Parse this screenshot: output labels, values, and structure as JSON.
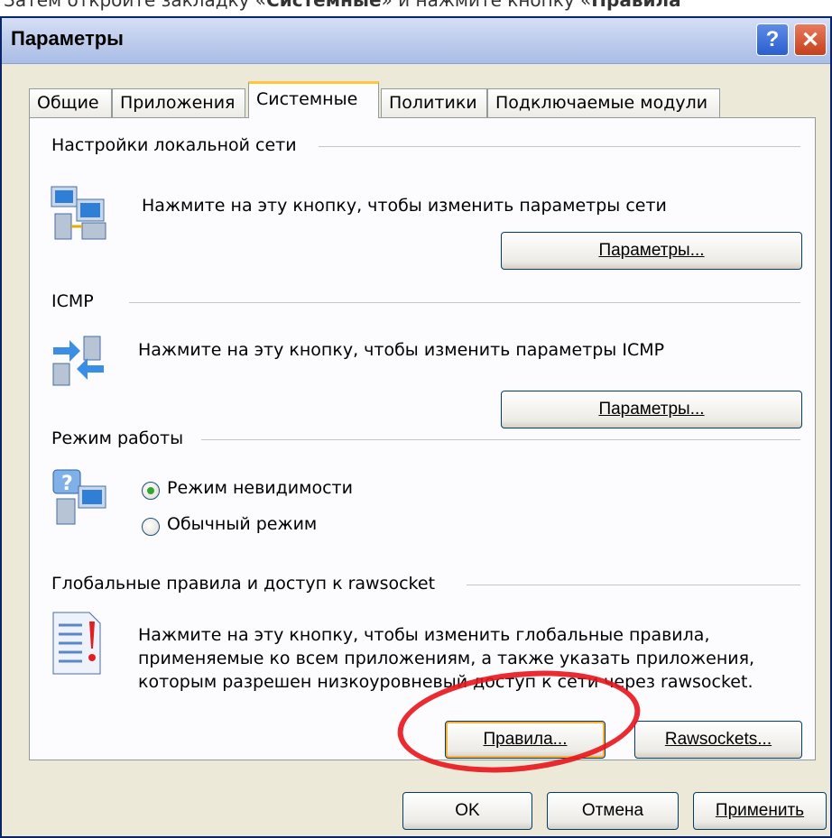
{
  "caption": {
    "prefix": "Затем откройте закладку «",
    "tab_name": "Системные",
    "middle": "» и нажмите кнопку «",
    "button_name": "Правила"
  },
  "window": {
    "title": "Параметры",
    "help_label": "?",
    "close_label": "✕"
  },
  "tabs": [
    {
      "label": "Общие"
    },
    {
      "label": "Приложения"
    },
    {
      "label": "Системные"
    },
    {
      "label": "Политики"
    },
    {
      "label": "Подключаемые модули"
    }
  ],
  "lan": {
    "title": "Настройки локальной сети",
    "description": "Нажмите на эту кнопку, чтобы изменить параметры сети",
    "button": "Параметры...",
    "icon": "network-computers-icon"
  },
  "icmp": {
    "title": "ICMP",
    "description": "Нажмите на эту кнопку, чтобы изменить параметры ICMP",
    "button": "Параметры...",
    "icon": "icmp-exchange-icon"
  },
  "mode": {
    "title": "Режим работы",
    "options": [
      {
        "label": "Режим невидимости",
        "checked": true
      },
      {
        "label": "Обычный режим",
        "checked": false
      }
    ],
    "icon": "question-computer-icon"
  },
  "global": {
    "title": "Глобальные правила и доступ к rawsocket",
    "lines": [
      "Нажмите на эту кнопку, чтобы изменить глобальные правила,",
      "применяемые ко всем приложениям, а также указать приложения,",
      "которым разрешен низкоуровневый доступ к сети через rawsocket."
    ],
    "rules_button": "Правила...",
    "rawsockets_button": "Rawsockets...",
    "icon": "document-warning-icon"
  },
  "footer": {
    "ok": "OK",
    "cancel": "Отмена",
    "apply": "Применить"
  },
  "colors": {
    "highlight": "#e8151c",
    "active_tab_accent": "#ffc83c",
    "dialog_bg": "#ece9d8"
  }
}
